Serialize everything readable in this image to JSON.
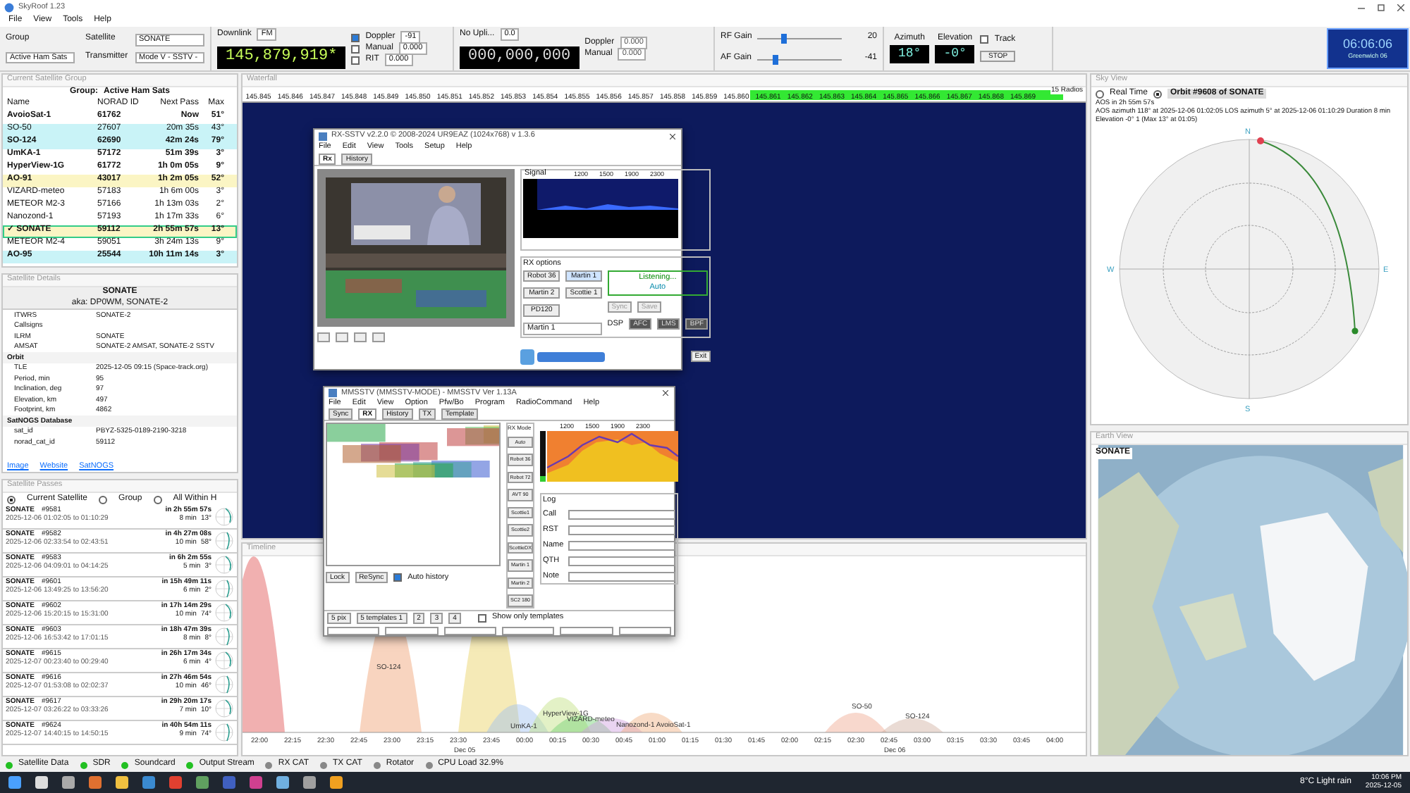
{
  "window": {
    "title": "SkyRoof 1.23"
  },
  "menu": [
    "File",
    "View",
    "Tools",
    "Help"
  ],
  "toolbar": {
    "group_label": "Group",
    "group_value": "Active Ham Sats",
    "satellite_label": "Satellite",
    "satellite_value": "SONATE",
    "transmitter_label": "Transmitter",
    "transmitter_value": "Mode V - SSTV -",
    "downlink": {
      "label": "Downlink",
      "mode": "FM",
      "frequency": "145,879,919*",
      "options": [
        {
          "label": "Doppler",
          "checked": true,
          "value": "-91"
        },
        {
          "label": "Manual",
          "checked": false,
          "value": "0.000"
        },
        {
          "label": "RIT",
          "checked": false,
          "value": "0.000"
        }
      ]
    },
    "uplink": {
      "label": "No Upli...",
      "mode": "0.0",
      "frequency": "000,000,000",
      "options": [
        {
          "label": "Doppler",
          "value": "0.000"
        },
        {
          "label": "Manual",
          "value": "0.000"
        }
      ]
    },
    "gains": [
      {
        "label": "RF Gain",
        "level": 0.3,
        "reading": "20"
      },
      {
        "label": "AF Gain",
        "level": 0.2,
        "reading": "-41"
      }
    ],
    "rotator": {
      "azimuth_label": "Azimuth",
      "azimuth": "18°",
      "elevation_label": "Elevation",
      "elevation": "-0°",
      "track": {
        "label": "Track",
        "checked": false
      },
      "stop": "STOP"
    },
    "clock": {
      "time": "06:06:06",
      "zone": "Greenwich 06"
    }
  },
  "satellite_group": {
    "title": "Current Satellite Group",
    "group_label": "Group:",
    "group_name": "Active Ham Sats",
    "columns": [
      "Name",
      "NORAD ID",
      "Next Pass",
      "Max"
    ],
    "rows": [
      {
        "name": "AvoioSat-1",
        "norad": "61762",
        "next_pass": "Now",
        "max": "51°",
        "bold": true,
        "selected": false
      },
      {
        "name": "SO-50",
        "norad": "27607",
        "next_pass": "20m 35s",
        "max": "43°",
        "bold": false,
        "selected": false,
        "color": "#c9f3f7"
      },
      {
        "name": "SO-124",
        "norad": "62690",
        "next_pass": "42m 24s",
        "max": "79°",
        "bold": true,
        "selected": false,
        "color": "#c9f3f7"
      },
      {
        "name": "UmKA-1",
        "norad": "57172",
        "next_pass": "51m 39s",
        "max": "3°",
        "bold": true,
        "selected": false
      },
      {
        "name": "HyperView-1G",
        "norad": "61772",
        "next_pass": "1h 0m 05s",
        "max": "9°",
        "bold": true,
        "selected": false
      },
      {
        "name": "AO-91",
        "norad": "43017",
        "next_pass": "1h 2m 05s",
        "max": "52°",
        "bold": true,
        "selected": false,
        "color": "#fbf5c4"
      },
      {
        "name": "VIZARD-meteo",
        "norad": "57183",
        "next_pass": "1h 6m 00s",
        "max": "3°",
        "bold": false,
        "selected": false
      },
      {
        "name": "METEOR M2-3",
        "norad": "57166",
        "next_pass": "1h 13m 03s",
        "max": "2°",
        "bold": false,
        "selected": false
      },
      {
        "name": "Nanozond-1",
        "norad": "57193",
        "next_pass": "1h 17m 33s",
        "max": "6°",
        "bold": false,
        "selected": false
      },
      {
        "check": "✓",
        "name": "SONATE",
        "norad": "59112",
        "next_pass": "2h 55m 57s",
        "max": "13°",
        "bold": true,
        "selected": true,
        "color": "#fbf5c4"
      },
      {
        "name": "METEOR M2-4",
        "norad": "59051",
        "next_pass": "3h 24m 13s",
        "max": "9°",
        "bold": false,
        "selected": false
      },
      {
        "name": "AO-95",
        "norad": "25544",
        "next_pass": "10h 11m 14s",
        "max": "3°",
        "bold": true,
        "selected": false,
        "color": "#c9f3f7"
      }
    ]
  },
  "satellite_details": {
    "title": "Satellite Details",
    "name": "SONATE",
    "aka": "aka: DP0WM, SONATE-2",
    "rows": [
      {
        "kind": "prop",
        "label": "ITWRS",
        "value": "SONATE-2"
      },
      {
        "kind": "prop",
        "label": "Callsigns"
      },
      {
        "kind": "prop",
        "label": "ILRM",
        "value": "SONATE"
      },
      {
        "kind": "prop",
        "label": "AMSAT",
        "value": "SONATE-2 AMSAT, SONATE-2 SSTV"
      },
      {
        "kind": "section",
        "label": "Orbit"
      },
      {
        "kind": "prop",
        "label": "TLE",
        "value": "2025-12-05 09:15 (Space-track.org)"
      },
      {
        "kind": "prop",
        "label": "Period, min",
        "value": "95"
      },
      {
        "kind": "prop",
        "label": "Inclination, deg",
        "value": "97"
      },
      {
        "kind": "prop",
        "label": "Elevation, km",
        "value": "497"
      },
      {
        "kind": "prop",
        "label": "Footprint, km",
        "value": "4862"
      },
      {
        "kind": "section",
        "label": "SatNOGS Database"
      },
      {
        "kind": "prop",
        "label": "sat_id",
        "value": "PBYZ-5325-0189-2190-3218"
      },
      {
        "kind": "prop",
        "label": "norad_cat_id",
        "value": "59112"
      }
    ],
    "links": [
      "Image",
      "Website",
      "SatNOGS"
    ]
  },
  "satellite_passes": {
    "title": "Satellite Passes",
    "filters": [
      {
        "label": "Current Satellite",
        "selected": true
      },
      {
        "label": "Group",
        "selected": false
      },
      {
        "label": "All Within H",
        "selected": false
      }
    ],
    "passes": [
      {
        "name": "SONATE",
        "orbit": "#9581",
        "countdown": "in 2h 55m 57s",
        "span": "2025-12-06 01:02:05 to 01:10:29",
        "duration": "8 min",
        "max": "13°"
      },
      {
        "name": "SONATE",
        "orbit": "#9582",
        "countdown": "in 4h 27m 08s",
        "span": "2025-12-06 02:33:54 to 02:43:51",
        "duration": "10 min",
        "max": "58°"
      },
      {
        "name": "SONATE",
        "orbit": "#9583",
        "countdown": "in 6h 2m 55s",
        "span": "2025-12-06 04:09:01 to 04:14:25",
        "duration": "5 min",
        "max": "3°"
      },
      {
        "name": "SONATE",
        "orbit": "#9601",
        "countdown": "in 15h 49m 11s",
        "span": "2025-12-06 13:49:25 to 13:56:20",
        "duration": "6 min",
        "max": "2°"
      },
      {
        "name": "SONATE",
        "orbit": "#9602",
        "countdown": "in 17h 14m 29s",
        "span": "2025-12-06 15:20:15 to 15:31:00",
        "duration": "10 min",
        "max": "74°"
      },
      {
        "name": "SONATE",
        "orbit": "#9603",
        "countdown": "in 18h 47m 39s",
        "span": "2025-12-06 16:53:42 to 17:01:15",
        "duration": "8 min",
        "max": "8°"
      },
      {
        "name": "SONATE",
        "orbit": "#9615",
        "countdown": "in 26h 17m 34s",
        "span": "2025-12-07 00:23:40 to 00:29:40",
        "duration": "6 min",
        "max": "4°"
      },
      {
        "name": "SONATE",
        "orbit": "#9616",
        "countdown": "in 27h 46m 54s",
        "span": "2025-12-07 01:53:08 to 02:02:37",
        "duration": "10 min",
        "max": "46°"
      },
      {
        "name": "SONATE",
        "orbit": "#9617",
        "countdown": "in 29h 20m 17s",
        "span": "2025-12-07 03:26:22 to 03:33:26",
        "duration": "7 min",
        "max": "10°"
      },
      {
        "name": "SONATE",
        "orbit": "#9624",
        "countdown": "in 40h 54m 11s",
        "span": "2025-12-07 14:40:15 to 14:50:15",
        "duration": "9 min",
        "max": "74°"
      }
    ]
  },
  "waterfall": {
    "title": "Waterfall",
    "scale": [
      "145.845",
      "145.846",
      "145.847",
      "145.848",
      "145.849",
      "145.850",
      "145.851",
      "145.852",
      "145.853",
      "145.854",
      "145.855",
      "145.856",
      "145.857",
      "145.858",
      "145.859",
      "145.860",
      "145.861",
      "145.862",
      "145.863",
      "145.864",
      "145.865",
      "145.866",
      "145.867",
      "145.868",
      "145.869"
    ],
    "radios": "15 Radios"
  },
  "rx_sstv": {
    "title": "RX-SSTV v2.2.0 © 2008-2024 UR9EAZ (1024x768) v 1.3.6",
    "menu": [
      "File",
      "Edit",
      "View",
      "Tools",
      "Setup",
      "Help"
    ],
    "tabs": [
      {
        "label": "Rx",
        "selected": true
      },
      {
        "label": "History",
        "selected": false
      }
    ],
    "signal_label": "Signal",
    "signal_ticks": [
      "1200",
      "1500",
      "1900",
      "2300"
    ],
    "options_label": "RX options",
    "modes": [
      {
        "label": "Robot 36",
        "selected": false
      },
      {
        "label": "Martin 1",
        "selected": true
      },
      {
        "label": "Martin 2",
        "selected": false
      },
      {
        "label": "Scottie 1",
        "selected": false
      },
      {
        "label": "PD120",
        "selected": false
      }
    ],
    "mode_select": "Martin 1",
    "listening": "Listening...",
    "auto": "Auto",
    "sync": "Sync",
    "save": "Save",
    "dsp_label": "DSP",
    "dsp": [
      "AFC",
      "LMS",
      "BPF"
    ],
    "exit": "Exit"
  },
  "mmsstv": {
    "title": "MMSSTV (MMSSTV-MODE) - MMSSTV Ver 1.13A",
    "menu": [
      "File",
      "Edit",
      "View",
      "Option",
      "Pfw/Bo",
      "Program",
      "RadioCommand",
      "Help"
    ],
    "tabs": [
      {
        "label": "Sync",
        "selected": false
      },
      {
        "label": "RX",
        "selected": true
      },
      {
        "label": "History",
        "selected": false
      },
      {
        "label": "TX",
        "selected": false
      },
      {
        "label": "Template",
        "selected": false
      }
    ],
    "mode_label": "RX Mode",
    "modes": [
      "Auto",
      "Robot 36",
      "Robot 72",
      "AVT 90",
      "Scottie1",
      "Scottie2",
      "ScottieDX",
      "Martin 1",
      "Martin 2",
      "SC2 180"
    ],
    "ticks": [
      "1200",
      "1500",
      "1900",
      "2300"
    ],
    "log_label": "Log",
    "fields": [
      "Call",
      "RST",
      "Name",
      "QTH",
      "Note"
    ],
    "lock": "Lock",
    "resync": "ReSync",
    "auto_history": {
      "label": "Auto history",
      "checked": true
    },
    "pages": [
      "5 pix",
      "5 templates 1",
      "2",
      "3",
      "4"
    ],
    "show_only": {
      "label": "Show only templates",
      "checked": false
    }
  },
  "timeline": {
    "title": "Timeline",
    "passes": [
      {
        "label": "SO-124"
      },
      {
        "label": "UmKA-1"
      },
      {
        "label": "HyperView-1G"
      },
      {
        "label": "VIZARD-meteo"
      },
      {
        "label": "Nanozond-1 AvoioSat-1"
      },
      {
        "label": "SO-50"
      },
      {
        "label": "SO-124"
      }
    ],
    "ticks": [
      "22:00",
      "22:15",
      "22:30",
      "22:45",
      "23:00",
      "23:15",
      "23:30",
      "23:45",
      "00:00",
      "00:15",
      "00:30",
      "00:45",
      "01:00",
      "01:15",
      "01:30",
      "01:45",
      "02:00",
      "02:15",
      "02:30",
      "02:45",
      "03:00",
      "03:15",
      "03:30",
      "03:45",
      "04:00"
    ],
    "dates": [
      "Dec 05",
      "Dec 06"
    ]
  },
  "sky_view": {
    "title": "Sky View",
    "modes": [
      {
        "label": "Real Time",
        "selected": false
      },
      {
        "label": "Orbit #9608 of SONATE",
        "selected": true
      }
    ],
    "lines": [
      "AOS in 2h 55m 57s",
      "AOS azimuth 118° at 2025-12-06 01:02:05   LOS azimuth 5° at 2025-12-06 01:10:29   Duration 8 min",
      "Elevation -0° 1   (Max 13° at 01:05)"
    ],
    "directions": [
      "N",
      "E",
      "S",
      "W"
    ]
  },
  "earth_view": {
    "title": "Earth View",
    "label": "SONATE"
  },
  "status_bar": [
    {
      "label": "Satellite Data",
      "on": true
    },
    {
      "label": "SDR",
      "on": true
    },
    {
      "label": "Soundcard",
      "on": true
    },
    {
      "label": "Output Stream",
      "on": true
    },
    {
      "label": "RX CAT",
      "on": false
    },
    {
      "label": "TX CAT",
      "on": false
    },
    {
      "label": "Rotator",
      "on": false
    },
    {
      "label": "CPU Load 32.9%",
      "on": false
    }
  ],
  "taskbar": {
    "weather": "8°C Light rain",
    "time": "10:06 PM",
    "date": "2025-12-05"
  }
}
